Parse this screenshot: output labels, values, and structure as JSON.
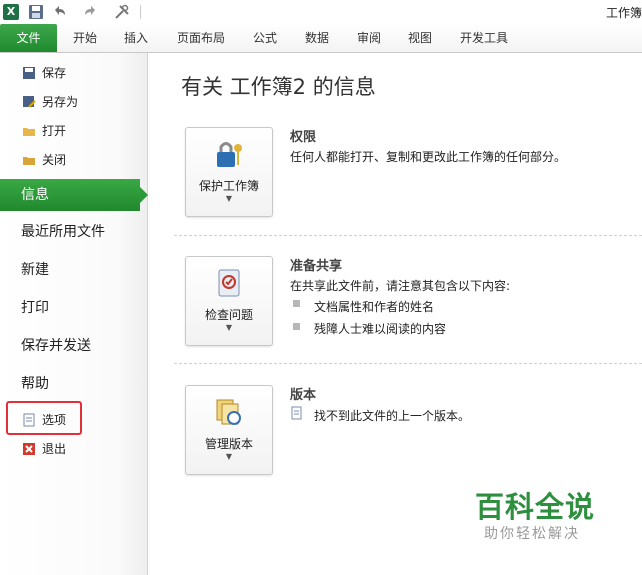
{
  "titlebar": {
    "title": "工作簿"
  },
  "tabs": [
    {
      "label": "文件"
    },
    {
      "label": "开始"
    },
    {
      "label": "插入"
    },
    {
      "label": "页面布局"
    },
    {
      "label": "公式"
    },
    {
      "label": "数据"
    },
    {
      "label": "审阅"
    },
    {
      "label": "视图"
    },
    {
      "label": "开发工具"
    }
  ],
  "nav": {
    "save": "保存",
    "save_as": "另存为",
    "open": "打开",
    "close": "关闭",
    "info": "信息",
    "recent": "最近所用文件",
    "new": "新建",
    "print": "打印",
    "save_send": "保存并发送",
    "help": "帮助",
    "options": "选项",
    "exit": "退出"
  },
  "main": {
    "title": "有关 工作簿2 的信息",
    "permissions": {
      "button": "保护工作簿",
      "heading": "权限",
      "desc": "任何人都能打开、复制和更改此工作簿的任何部分。"
    },
    "prepare": {
      "button": "检查问题",
      "heading": "准备共享",
      "desc": "在共享此文件前，请注意其包含以下内容:",
      "bullets": [
        "文档属性和作者的姓名",
        "残障人士难以阅读的内容"
      ]
    },
    "versions": {
      "button": "管理版本",
      "heading": "版本",
      "desc": "找不到此文件的上一个版本。"
    }
  },
  "watermark": {
    "title": "百科全说",
    "subtitle": "助你轻松解决"
  },
  "colors": {
    "accent": "#20892e",
    "highlight": "#e0303a"
  }
}
